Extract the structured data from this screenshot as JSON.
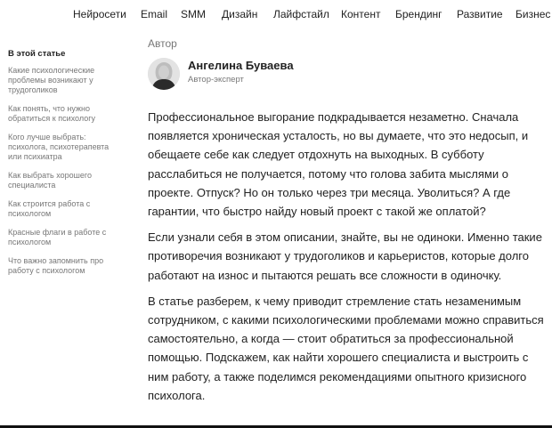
{
  "nav": {
    "items": [
      "Нейросети",
      "Email",
      "SMM",
      "Дизайн",
      "Лайфстайл",
      "Контент",
      "Брендинг",
      "Развитие",
      "Бизнес"
    ]
  },
  "sidebar": {
    "heading": "В этой статье",
    "links": [
      "Какие психологические проблемы возникают у трудоголиков",
      "Как понять, что нужно обратиться к психологу",
      "Кого лучше выбрать: психолога, психотерапевта или психиатра",
      "Как выбрать хорошего специалиста",
      "Как строится работа с психологом",
      "Красные флаги в работе с психологом",
      "Что важно запомнить про работу с психологом"
    ]
  },
  "author": {
    "label": "Автор",
    "name": "Ангелина Буваева",
    "role": "Автор-эксперт"
  },
  "article": {
    "paragraphs": [
      "Профессиональное выгорание подкрадывается незаметно. Сначала появляется хроническая усталость, но вы думаете, что это недосып, и обещаете себе как следует отдохнуть на выходных. В субботу расслабиться не получается, потому что голова забита мыслями о проекте. Отпуск? Но он только через три месяца. Уволиться? А где гарантии, что быстро найду новый проект с такой же оплатой?",
      "Если узнали себя в этом описании, знайте, вы не одиноки. Именно такие противоречия возникают у трудоголиков и карьеристов, которые долго работают на износ и пытаются решать все сложности в одиночку.",
      "В статье разберем, к чему приводит стремление стать незаменимым сотрудником, с какими психологическими проблемами можно справиться самостоятельно, а когда — стоит обратиться за профессиональной помощью. Подскажем, как найти хорошего специалиста и выстроить с ним работу, а также поделимся рекомендациями опытного кризисного психолога."
    ]
  }
}
